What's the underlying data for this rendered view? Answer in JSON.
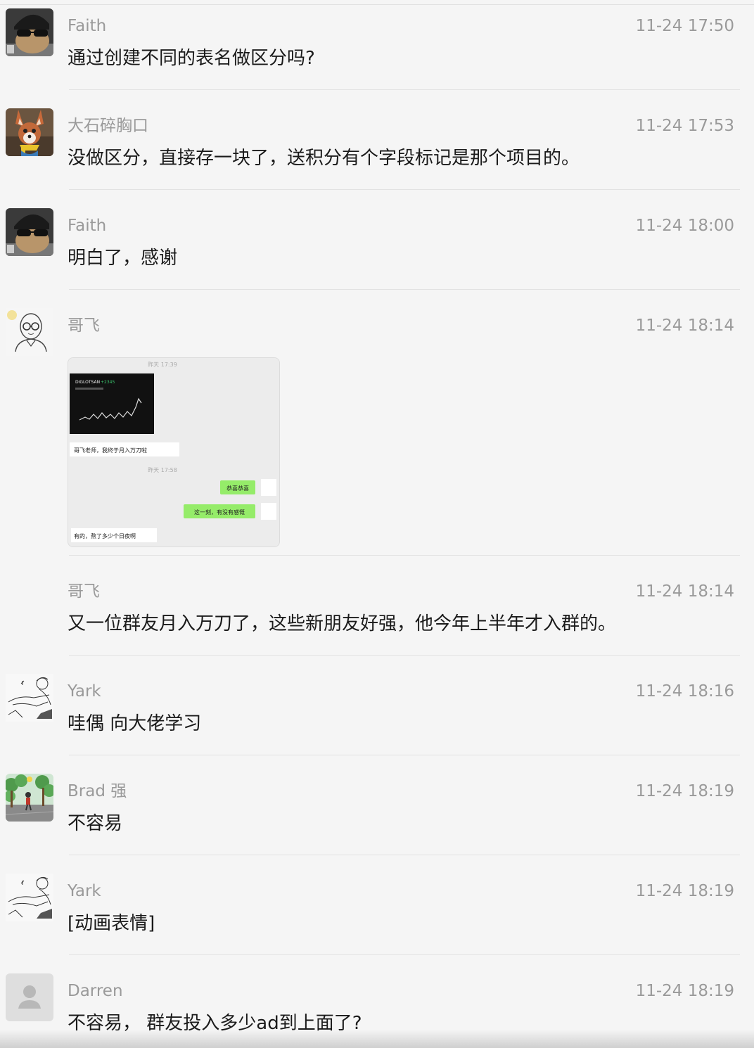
{
  "messages": [
    {
      "sender": "Faith",
      "time": "11-24 17:50",
      "text": "通过创建不同的表名做区分吗?"
    },
    {
      "sender": "大石碎胸口",
      "time": "11-24 17:53",
      "text": "没做区分，直接存一块了，送积分有个字段标记是那个项目的。"
    },
    {
      "sender": "Faith",
      "time": "11-24 18:00",
      "text": "明白了，感谢"
    },
    {
      "sender": "哥飞",
      "time": "11-24 18:14",
      "image": {
        "top_time": "昨天 17:39",
        "caption": "哥飞老师，我终于月入万刀啦",
        "mid_time": "昨天 17:58",
        "bubble1": "恭喜恭喜",
        "bubble2": "这一刻，有没有感慨",
        "reply": "有的，熬了多少个日夜啊",
        "chart_title": "DIGLOTSAN",
        "chart_badge": "+2345"
      }
    },
    {
      "sender": "哥飞",
      "time": "11-24 18:14",
      "text": "又一位群友月入万刀了，这些新朋友好强，他今年上半年才入群的。"
    },
    {
      "sender": "Yark",
      "time": "11-24 18:16",
      "text": "哇偶 向大佬学习"
    },
    {
      "sender": "Brad 强",
      "time": "11-24 18:19",
      "text": "不容易"
    },
    {
      "sender": "Yark",
      "time": "11-24 18:19",
      "text": "[动画表情]"
    },
    {
      "sender": "Darren",
      "time": "11-24 18:19",
      "text": "不容易，  群友投入多少ad到上面了?"
    }
  ],
  "avatar_icons": [
    "sunglasses-avatar-icon",
    "fox-avatar-icon",
    "sunglasses-avatar-icon",
    "glasses-man-avatar-icon",
    "sketch-avatar-icon",
    "trees-avatar-icon",
    "sketch-avatar-icon",
    "default-user-avatar-icon"
  ]
}
